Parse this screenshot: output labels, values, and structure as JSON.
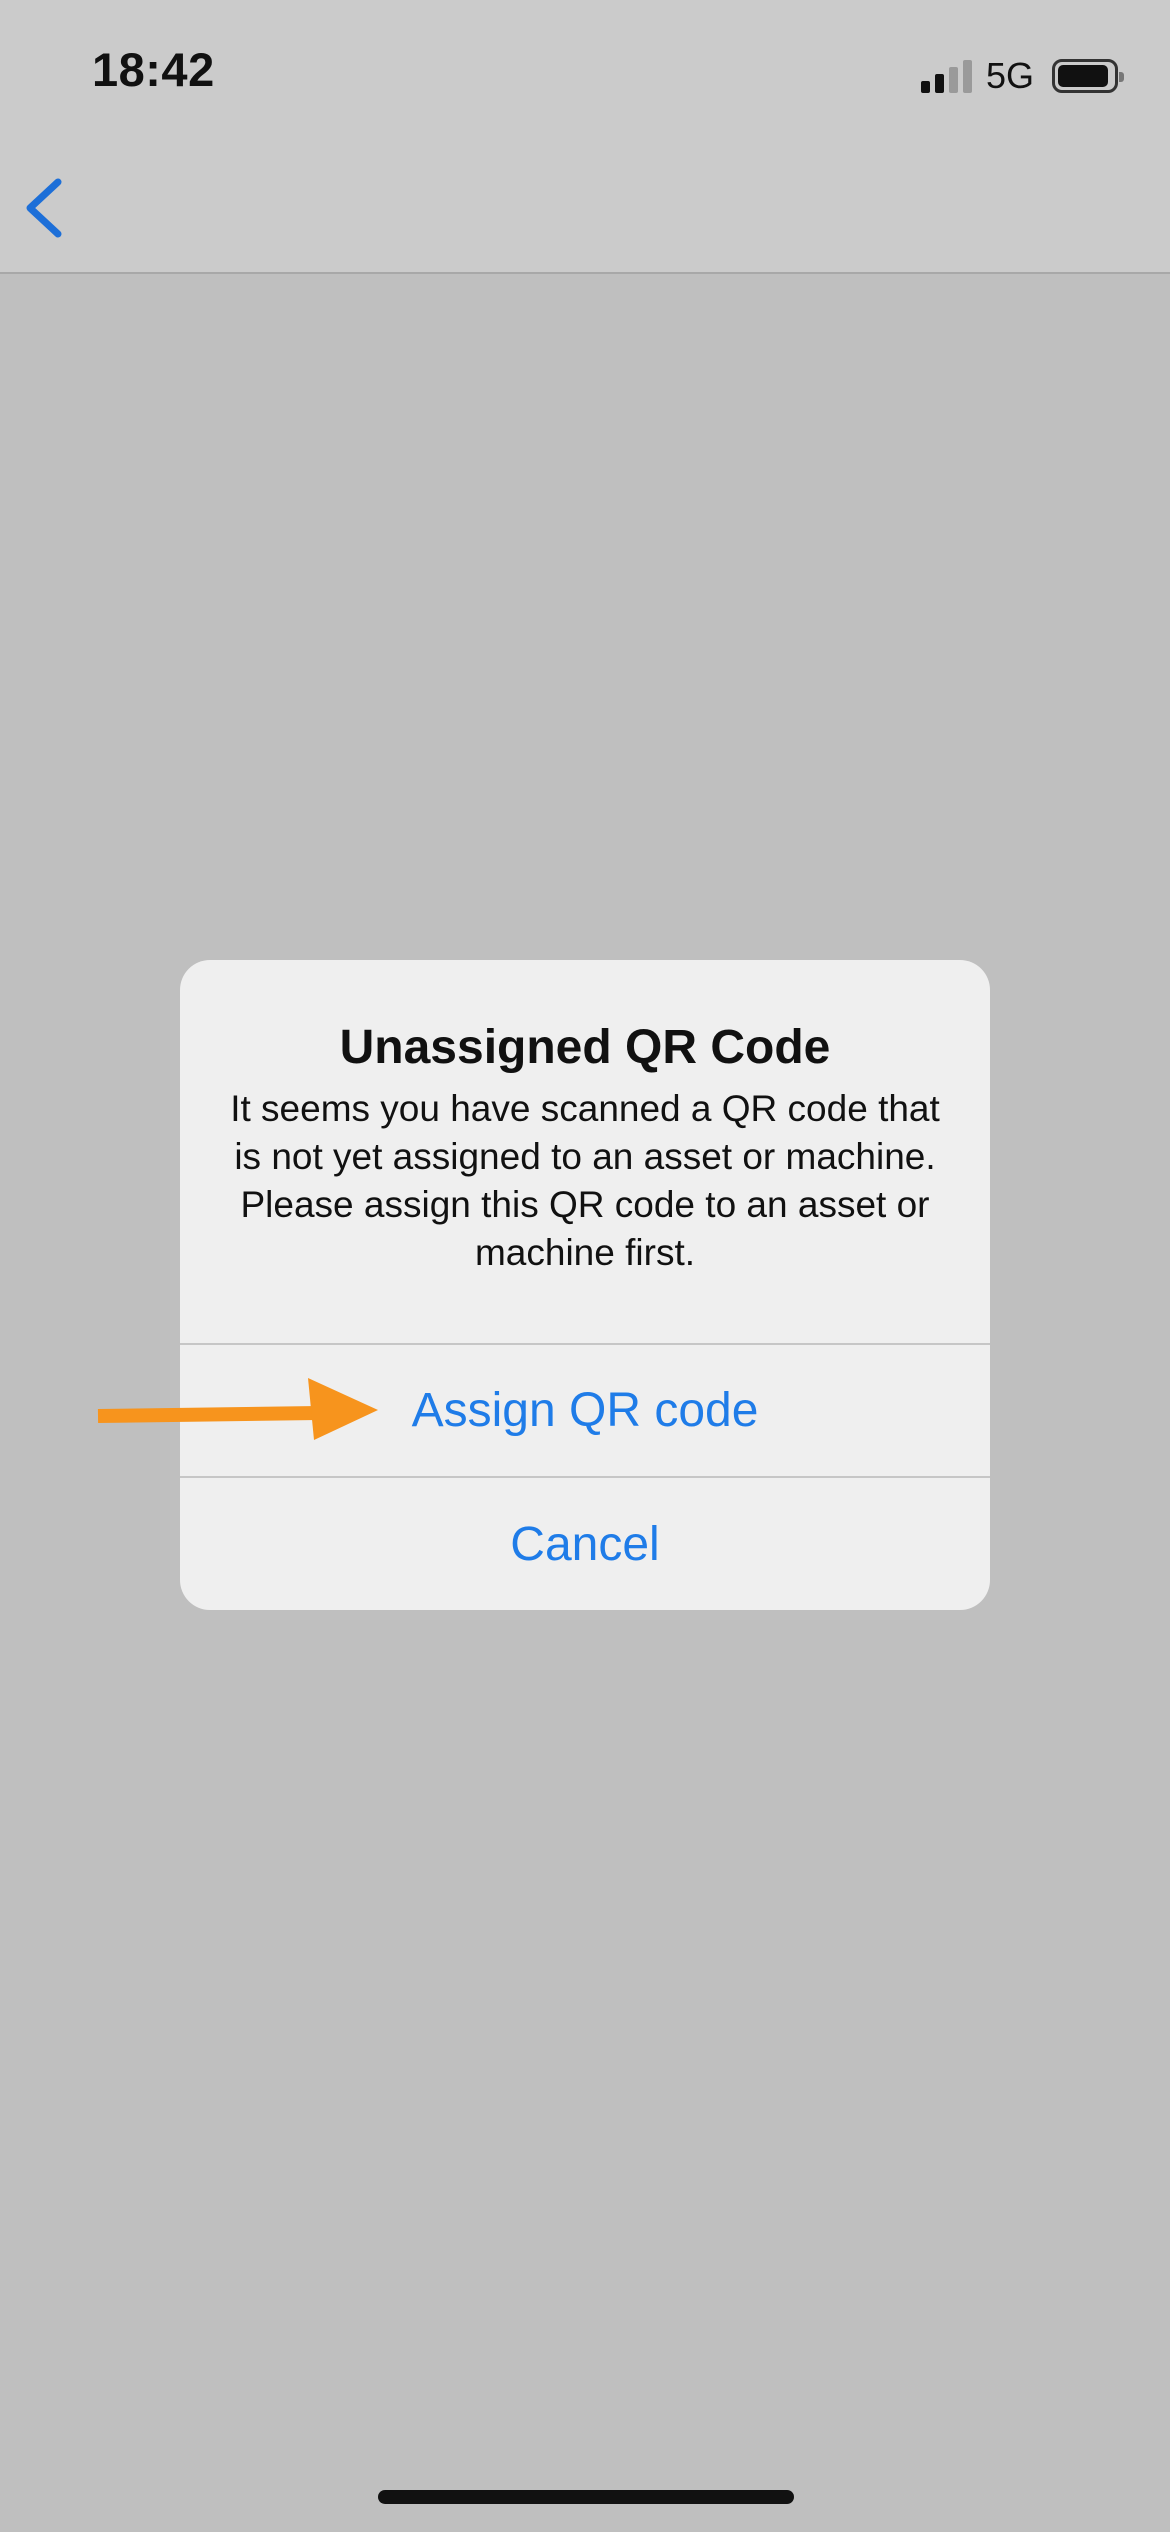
{
  "status_bar": {
    "time": "18:42",
    "network": "5G",
    "signal_bars_active": 2,
    "signal_bars_total": 4
  },
  "nav": {
    "back_icon": "chevron-left-icon"
  },
  "alert": {
    "title": "Unassigned QR Code",
    "message": "It seems you have scanned a QR code that is not yet assigned to an asset or machine. Please assign this QR code to an asset or machine first.",
    "primary_action": "Assign QR code",
    "cancel_action": "Cancel"
  },
  "annotation": {
    "icon": "orange-arrow-icon",
    "color": "#f7941d"
  },
  "colors": {
    "accent": "#1f7ce8",
    "background": "#bfbfbf",
    "alert_background": "#efefef"
  }
}
